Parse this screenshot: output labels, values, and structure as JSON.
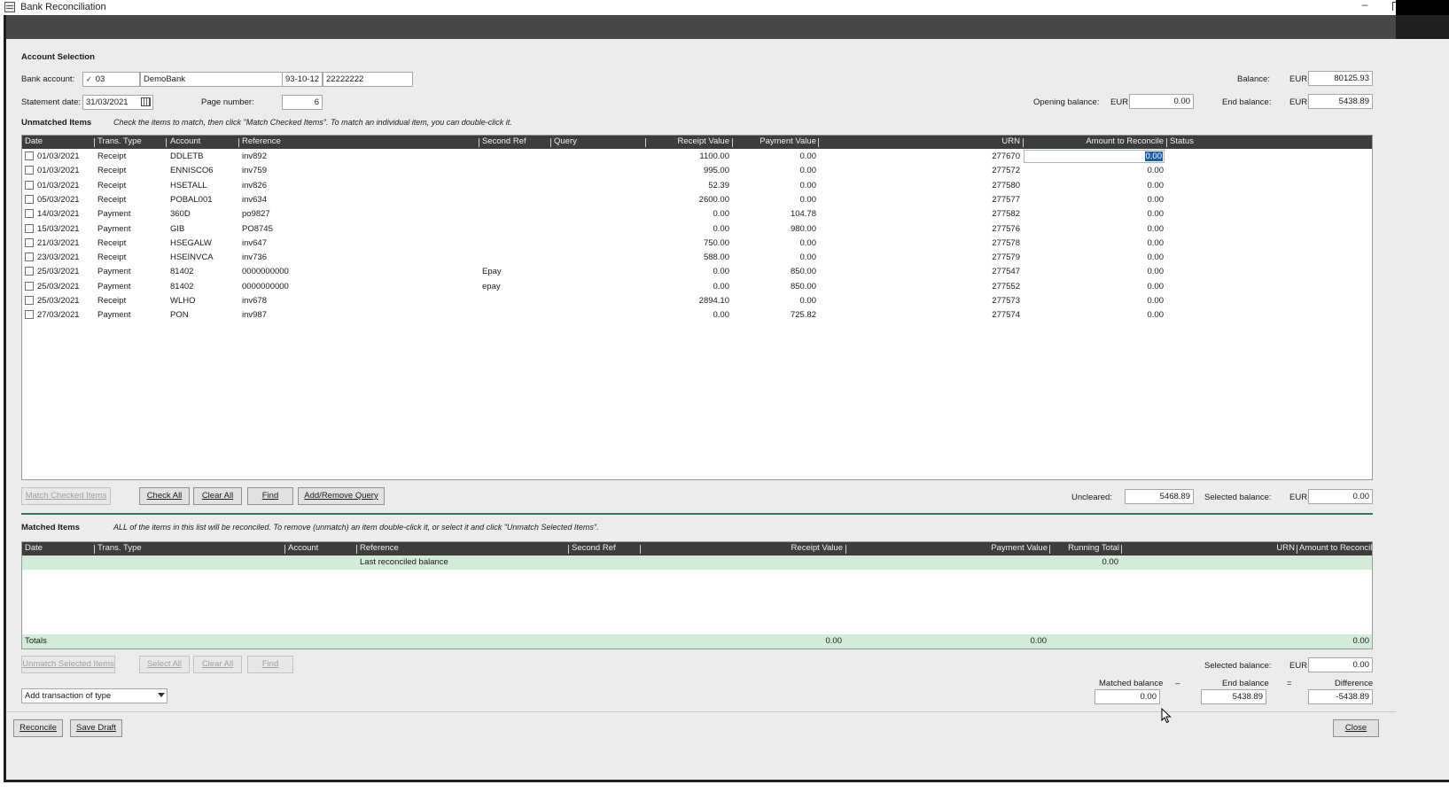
{
  "window": {
    "title": "Bank Reconciliation"
  },
  "account_selection": {
    "heading": "Account Selection",
    "bank_account_label": "Bank account:",
    "bank_code": "03",
    "bank_name": "DemoBank",
    "sort_code": "93-10-12",
    "account_number": "22222222",
    "statement_date_label": "Statement date:",
    "statement_date": "31/03/2021",
    "page_number_label": "Page number:",
    "page_number": "6",
    "balance_label": "Balance:",
    "balance_currency": "EUR",
    "balance": "80125.93",
    "opening_balance_label": "Opening balance:",
    "opening_currency": "EUR",
    "opening_balance": "0.00",
    "end_balance_label": "End balance:",
    "end_currency": "EUR",
    "end_balance": "5438.89"
  },
  "unmatched": {
    "heading": "Unmatched Items",
    "hint": "Check the items to match, then click \"Match Checked Items\". To match an individual item, you can double-click it.",
    "columns": [
      "Date",
      "Trans. Type",
      "Account",
      "Reference",
      "Second Ref",
      "Query",
      "Receipt Value",
      "Payment Value",
      "URN",
      "Amount to Reconcile",
      "Status"
    ],
    "rows": [
      {
        "date": "01/03/2021",
        "type": "Receipt",
        "account": "DDLETB",
        "reference": "inv892",
        "second_ref": "",
        "receipt": "1100.00",
        "payment": "0.00",
        "urn": "277670",
        "amount": "0.00"
      },
      {
        "date": "01/03/2021",
        "type": "Receipt",
        "account": "ENNISCO6",
        "reference": "inv759",
        "second_ref": "",
        "receipt": "995.00",
        "payment": "0.00",
        "urn": "277572",
        "amount": "0.00"
      },
      {
        "date": "01/03/2021",
        "type": "Receipt",
        "account": "HSETALL",
        "reference": "inv826",
        "second_ref": "",
        "receipt": "52.39",
        "payment": "0.00",
        "urn": "277580",
        "amount": "0.00"
      },
      {
        "date": "05/03/2021",
        "type": "Receipt",
        "account": "POBAL001",
        "reference": "inv634",
        "second_ref": "",
        "receipt": "2600.00",
        "payment": "0.00",
        "urn": "277577",
        "amount": "0.00"
      },
      {
        "date": "14/03/2021",
        "type": "Payment",
        "account": "360D",
        "reference": "po9827",
        "second_ref": "",
        "receipt": "0.00",
        "payment": "104.78",
        "urn": "277582",
        "amount": "0.00"
      },
      {
        "date": "15/03/2021",
        "type": "Payment",
        "account": "GIB",
        "reference": "PO8745",
        "second_ref": "",
        "receipt": "0.00",
        "payment": "980.00",
        "urn": "277576",
        "amount": "0.00"
      },
      {
        "date": "21/03/2021",
        "type": "Receipt",
        "account": "HSEGALW",
        "reference": "inv647",
        "second_ref": "",
        "receipt": "750.00",
        "payment": "0.00",
        "urn": "277578",
        "amount": "0.00"
      },
      {
        "date": "23/03/2021",
        "type": "Receipt",
        "account": "HSEINVCA",
        "reference": "inv736",
        "second_ref": "",
        "receipt": "588.00",
        "payment": "0.00",
        "urn": "277579",
        "amount": "0.00"
      },
      {
        "date": "25/03/2021",
        "type": "Payment",
        "account": "81402",
        "reference": "0000000000",
        "second_ref": "Epay",
        "receipt": "0.00",
        "payment": "850.00",
        "urn": "277547",
        "amount": "0.00"
      },
      {
        "date": "25/03/2021",
        "type": "Payment",
        "account": "81402",
        "reference": "0000000000",
        "second_ref": "epay",
        "receipt": "0.00",
        "payment": "850.00",
        "urn": "277552",
        "amount": "0.00"
      },
      {
        "date": "25/03/2021",
        "type": "Receipt",
        "account": "WLHO",
        "reference": "inv678",
        "second_ref": "",
        "receipt": "2894.10",
        "payment": "0.00",
        "urn": "277573",
        "amount": "0.00"
      },
      {
        "date": "27/03/2021",
        "type": "Payment",
        "account": "PON",
        "reference": "inv987",
        "second_ref": "",
        "receipt": "0.00",
        "payment": "725.82",
        "urn": "277574",
        "amount": "0.00"
      }
    ],
    "buttons": {
      "match_checked": "Match Checked Items",
      "check_all": "Check All",
      "clear_all": "Clear All",
      "find": "Find",
      "add_remove_query": "Add/Remove Query"
    },
    "uncleared_label": "Uncleared:",
    "uncleared": "5468.89",
    "selected_balance_label": "Selected balance:",
    "selected_currency": "EUR",
    "selected_balance": "0.00"
  },
  "matched": {
    "heading": "Matched Items",
    "hint": "ALL of the items in this list will be reconciled. To remove (unmatch) an item double-click it, or select it and click \"Unmatch Selected Items\".",
    "columns": [
      "Date",
      "Trans. Type",
      "Account",
      "Reference",
      "Second Ref",
      "Receipt Value",
      "Payment Value",
      "Running Total",
      "URN",
      "Amount to Reconcile"
    ],
    "last_reconciled_label": "Last reconciled balance",
    "last_reconciled_total": "0.00",
    "totals_label": "Totals",
    "totals_receipt": "0.00",
    "totals_payment": "0.00",
    "totals_amount": "0.00",
    "buttons": {
      "unmatch_selected": "Unmatch Selected Items",
      "select_all": "Select All",
      "clear_all": "Clear All",
      "find": "Find"
    },
    "selected_balance_label": "Selected balance:",
    "selected_currency": "EUR",
    "selected_balance": "0.00",
    "add_transaction": "Add transaction of type",
    "matched_balance_label": "Matched balance",
    "minus": "–",
    "end_balance_label": "End balance",
    "equals": "=",
    "difference_label": "Difference",
    "matched_balance": "0.00",
    "end_balance": "5438.89",
    "difference": "-5438.89"
  },
  "footer": {
    "reconcile": "Reconcile",
    "save_draft": "Save Draft",
    "close": "Close"
  }
}
